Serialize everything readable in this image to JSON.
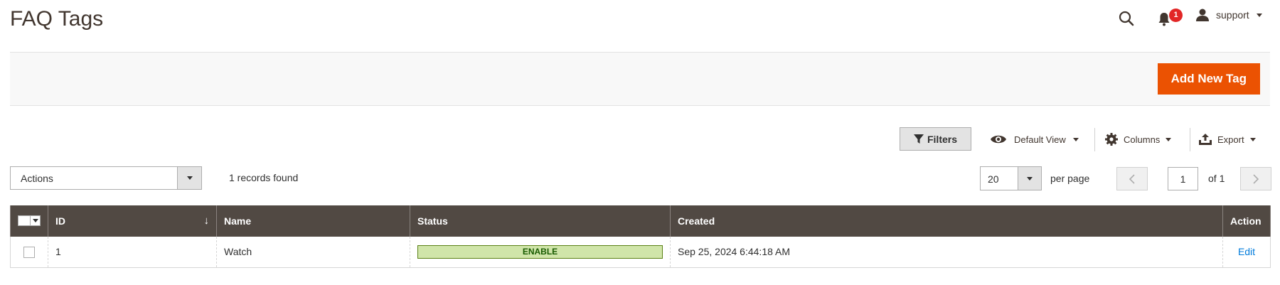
{
  "header": {
    "title": "FAQ Tags",
    "notifications_count": "1",
    "user_name": "support"
  },
  "action_bar": {
    "add_button_label": "Add New Tag"
  },
  "toolbar": {
    "filters_label": "Filters",
    "view_label": "Default View",
    "columns_label": "Columns",
    "export_label": "Export"
  },
  "mass_actions": {
    "label": "Actions",
    "records_found": "1 records found"
  },
  "pagination": {
    "per_page_value": "20",
    "per_page_label": "per page",
    "current_page": "1",
    "of_label": "of 1"
  },
  "grid": {
    "columns": [
      "",
      "ID",
      "Name",
      "Status",
      "Created",
      "Action"
    ],
    "sort_indicator": "↓",
    "rows": [
      {
        "id": "1",
        "name": "Watch",
        "status": "ENABLE",
        "created": "Sep 25, 2024 6:44:18 AM",
        "action": "Edit"
      }
    ]
  },
  "colors": {
    "accent": "#eb5202",
    "grid_header": "#514943",
    "status_enable_bg": "#d0e5a9",
    "link": "#007bdb",
    "badge": "#e22626"
  }
}
